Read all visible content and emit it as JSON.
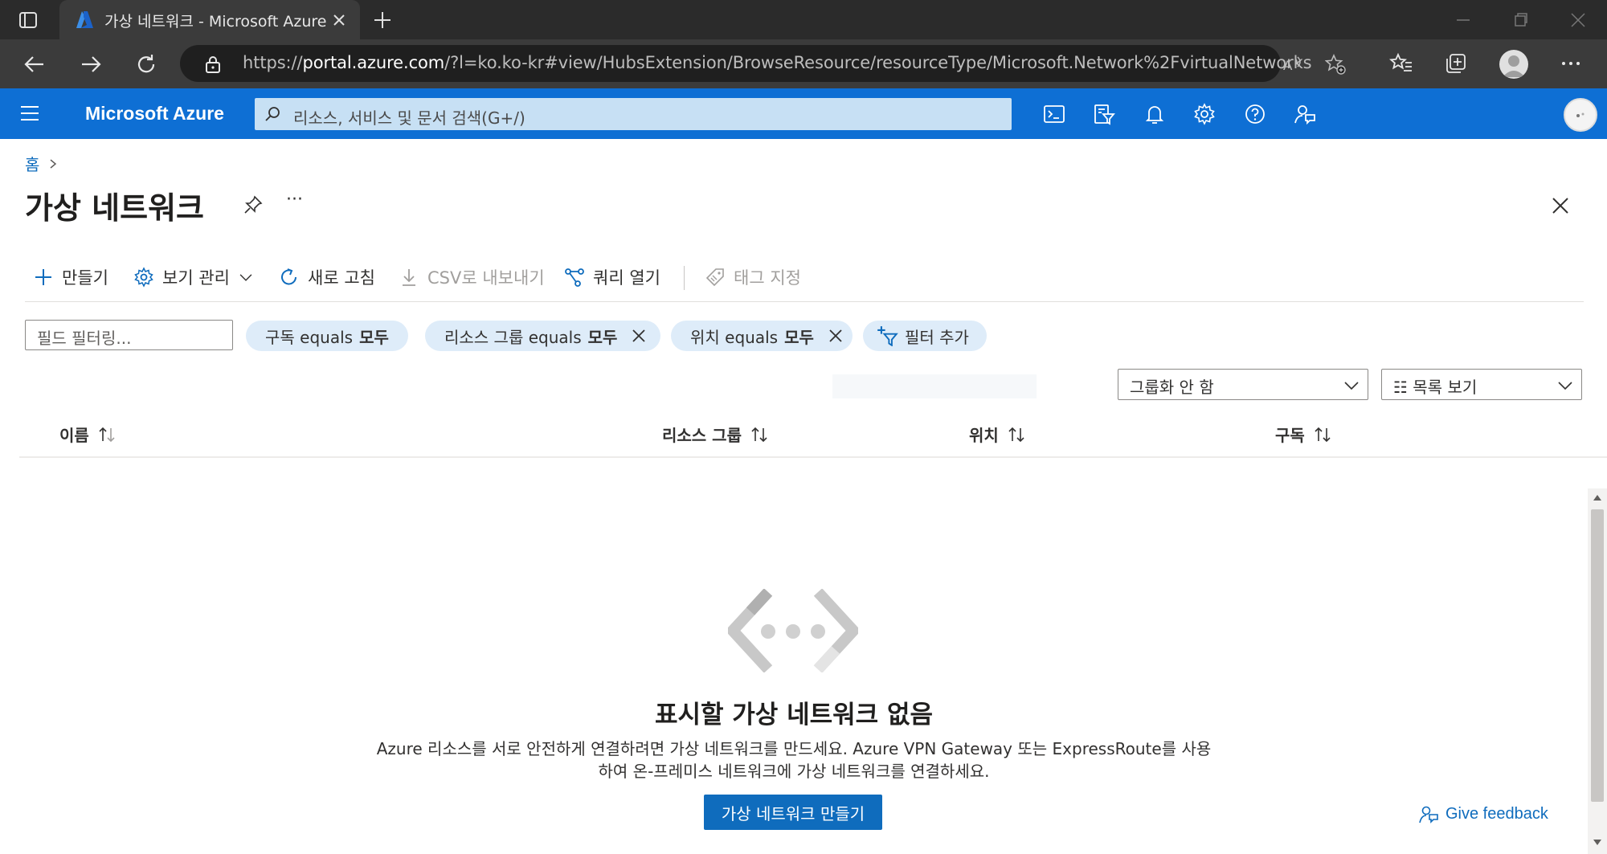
{
  "browser": {
    "tab_title": "가상 네트워크 - Microsoft Azure",
    "url_prefix": "https://",
    "url_host": "portal.azure.com",
    "url_rest": "/?l=ko.ko-kr#view/HubsExtension/BrowseResource/resourceType/Microsoft.Network%2FvirtualNetworks"
  },
  "azure_bar": {
    "brand": "Microsoft Azure",
    "search_placeholder": "리소스, 서비스 및 문서 검색(G+/)"
  },
  "breadcrumb": {
    "home": "홈"
  },
  "page": {
    "title": "가상 네트워크",
    "more": "···"
  },
  "commands": {
    "create": "만들기",
    "manage_view": "보기 관리",
    "refresh": "새로 고침",
    "export_csv": "CSV로 내보내기",
    "open_query": "쿼리 열기",
    "assign_tags": "태그 지정"
  },
  "filters": {
    "field_placeholder": "필드 필터링...",
    "subscription": {
      "label": "구독 equals",
      "value": "모두"
    },
    "resource_group": {
      "label": "리소스 그룹 equals",
      "value": "모두"
    },
    "location": {
      "label": "위치 equals",
      "value": "모두"
    },
    "add_filter": "필터 추가"
  },
  "view_controls": {
    "grouping": "그룹화 안 함",
    "view_mode": "☷ 목록 보기"
  },
  "columns": {
    "name": "이름",
    "resource_group": "리소스 그룹",
    "location": "위치",
    "subscription": "구독"
  },
  "empty_state": {
    "title": "표시할 가상 네트워크 없음",
    "description_line1": "Azure 리소스를 서로 안전하게 연결하려면 가상 네트워크를 만드세요. Azure VPN Gateway 또는 ExpressRoute를 사용",
    "description_line2": "하여 온-프레미스 네트워크에 가상 네트워크를 연결하세요.",
    "button": "가상 네트워크 만들기"
  },
  "feedback": {
    "label": "Give feedback"
  },
  "colors": {
    "azure_blue": "#0e6fd4",
    "link": "#0f6cbd",
    "pill_bg": "#deecf9"
  }
}
